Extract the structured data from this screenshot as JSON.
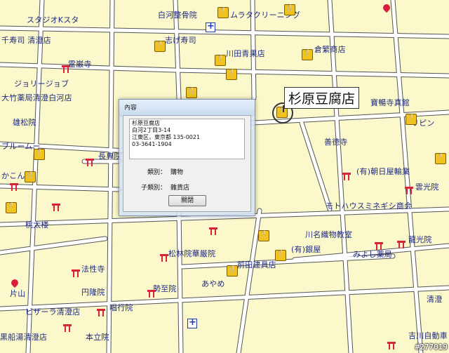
{
  "map_labels": [
    "スタジオKスタ",
    "白河整骨院",
    "ムラタクリーニング",
    "千寿司 清澄店",
    "志げ寿司",
    "川田青果店",
    "倉繁商店",
    "霊巌寺",
    "ジョリージョブ",
    "大竹薬局清澄白河店",
    "雄松院",
    "寶暢寺真館",
    "リピン",
    "ブルームー",
    "善徳寺",
    "長専院",
    "かこんC",
    "(有)朝日屋輸業",
    "雲光院",
    "モトハウスミネギシ商会",
    "桃太楼",
    "川名織物教室",
    "龍光院",
    "(有)銀屋",
    "松林院華厳院",
    "みよし薬局",
    "前田建具店",
    "法性寺",
    "あやめ",
    "円隆院",
    "勢至院",
    "唱行院",
    "ビザーラ清澄店",
    "片山",
    "黒船湯清澄店",
    "本立院",
    "吉川自動車",
    "清澄"
  ],
  "callout": {
    "label": "杉原豆腐店"
  },
  "dialog": {
    "title": "內容",
    "address_lines": [
      "杉原豆腐店",
      "白河2丁目3-14",
      "江東区，東京都 135-0021",
      "03-3641-1904"
    ],
    "category_label": "類別：",
    "category_value": "購物",
    "subcategory_label": "子類別：",
    "subcategory_value": "雜貨店",
    "close_button": "關閉"
  },
  "watermark": "#277019",
  "colors": {
    "map_bg": "#fbf8cc",
    "road": "#ffffff",
    "road_edge": "#555555",
    "label": "#1f2a80",
    "temple": "#d8243a"
  }
}
